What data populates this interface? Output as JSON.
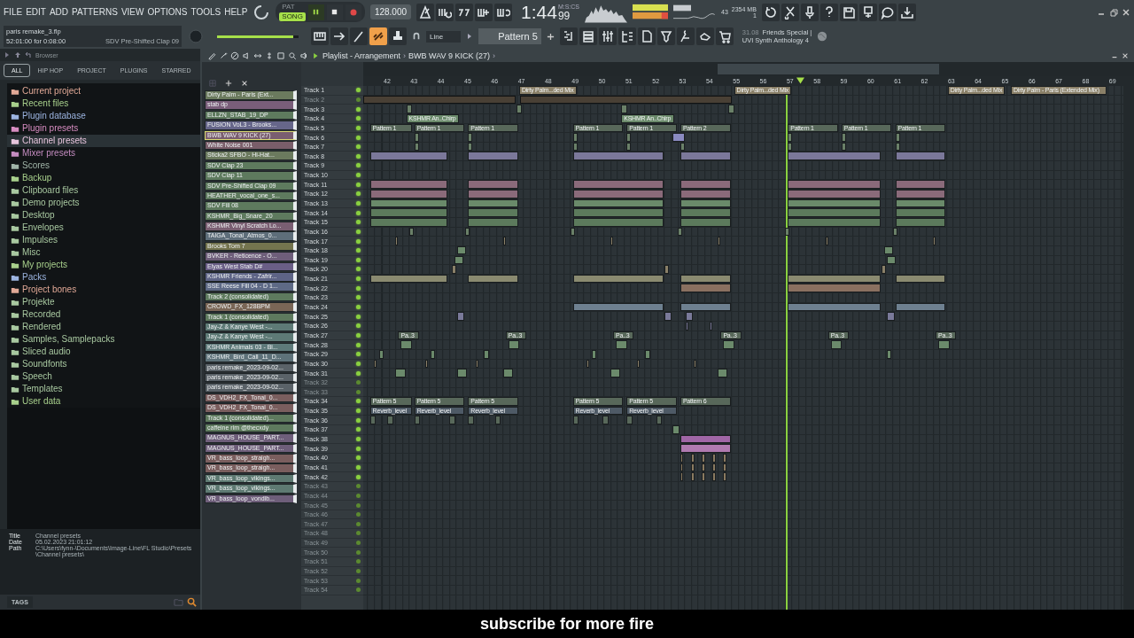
{
  "menu": [
    "FILE",
    "EDIT",
    "ADD",
    "PATTERNS",
    "VIEW",
    "OPTIONS",
    "TOOLS",
    "HELP"
  ],
  "transport": {
    "modes": [
      {
        "label": "PAT",
        "selected": false
      },
      {
        "label": "SONG",
        "selected": true
      }
    ],
    "tempo": "128.000",
    "time_main": "1:44",
    "time_cs": "99",
    "time_units": "M:S:CS"
  },
  "resources": {
    "polyphony": "43",
    "memory": "2354 MB",
    "cpu": "1"
  },
  "project": {
    "file": "paris remake_3.flp",
    "span": "52:01:00 for 0:08:00",
    "hint": "SDV Pre-Shifted Clap 09"
  },
  "master_volume": {
    "level": 0.93
  },
  "link_tool": {
    "on": true
  },
  "snap": {
    "value": "Line"
  },
  "pattern_selector": {
    "value": "Pattern 5"
  },
  "news": {
    "date": "31.08",
    "line1": "Friends Special |",
    "line2": "UVI Synth Anthology 4"
  },
  "browser": {
    "title": "Browser",
    "tabs": [
      {
        "label": "ALL",
        "selected": true
      },
      {
        "label": "HIP HOP",
        "selected": false
      },
      {
        "label": "PROJECT",
        "selected": false
      },
      {
        "label": "PLUGINS",
        "selected": false
      },
      {
        "label": "STARRED",
        "selected": false
      }
    ],
    "items": [
      {
        "label": "Current project",
        "color": "#e0a896",
        "selected": false
      },
      {
        "label": "Recent files",
        "color": "#a8d08c",
        "selected": false
      },
      {
        "label": "Plugin database",
        "color": "#9cb4e0",
        "selected": false
      },
      {
        "label": "Plugin presets",
        "color": "#d68cc0",
        "selected": false
      },
      {
        "label": "Channel presets",
        "color": "#e6c4dc",
        "selected": true
      },
      {
        "label": "Mixer presets",
        "color": "#c48cc0",
        "selected": false
      },
      {
        "label": "Scores",
        "color": "#a0b4a8",
        "selected": false
      },
      {
        "label": "Backup",
        "color": "#a8d08c",
        "selected": false
      },
      {
        "label": "Clipboard files",
        "color": "#a8c8a0",
        "selected": false
      },
      {
        "label": "Demo projects",
        "color": "#a8c8a0",
        "selected": false
      },
      {
        "label": "Desktop",
        "color": "#a8c8a0",
        "selected": false
      },
      {
        "label": "Envelopes",
        "color": "#a8c8a0",
        "selected": false
      },
      {
        "label": "Impulses",
        "color": "#a8c8a0",
        "selected": false
      },
      {
        "label": "Misc",
        "color": "#a8c8a0",
        "selected": false
      },
      {
        "label": "My projects",
        "color": "#a8d08c",
        "selected": false
      },
      {
        "label": "Packs",
        "color": "#9cb4e0",
        "selected": false
      },
      {
        "label": "Project bones",
        "color": "#e0a896",
        "selected": false
      },
      {
        "label": "Projekte",
        "color": "#a8c8a0",
        "selected": false
      },
      {
        "label": "Recorded",
        "color": "#a8c8a0",
        "selected": false
      },
      {
        "label": "Rendered",
        "color": "#a8c8a0",
        "selected": false
      },
      {
        "label": "Samples, Samplepacks",
        "color": "#a8c8a0",
        "selected": false
      },
      {
        "label": "Sliced audio",
        "color": "#a8c8a0",
        "selected": false
      },
      {
        "label": "Soundfonts",
        "color": "#a8c8a0",
        "selected": false
      },
      {
        "label": "Speech",
        "color": "#a8c8a0",
        "selected": false
      },
      {
        "label": "Templates",
        "color": "#a8c8a0",
        "selected": false
      },
      {
        "label": "User data",
        "color": "#a8d08c",
        "selected": false
      }
    ],
    "info": [
      {
        "key": "Title",
        "value": "Channel presets"
      },
      {
        "key": "Date",
        "value": "05.02.2023 21:01:12"
      },
      {
        "key": "Path",
        "value": "C:\\Users\\fynn-\\Documents\\Image-Line\\FL Studio\\Presets\\Channel presets\\"
      }
    ],
    "tags_label": "TAGS"
  },
  "playlist": {
    "title": "Playlist - Arrangement",
    "separator": "›",
    "current": "BWB WAV 9 KICK (27)",
    "end_separator": "›",
    "bars": [
      "42",
      "43",
      "44",
      "45",
      "46",
      "47",
      "48",
      "49",
      "50",
      "51",
      "52",
      "53",
      "54",
      "55",
      "56",
      "57",
      "58",
      "59",
      "60",
      "61",
      "62",
      "63",
      "64",
      "65",
      "66",
      "67",
      "68",
      "69"
    ],
    "channels": [
      {
        "name": "Dirty Palm - Paris (Ext...",
        "color": "#6b7a5e",
        "selected": false
      },
      {
        "name": "stab dp",
        "color": "#7a5e7a",
        "selected": false
      },
      {
        "name": "ELLZN_STAB_19_DP",
        "color": "#5e7a5e",
        "selected": false
      },
      {
        "name": "FUSION VoL3 - Brooks...",
        "color": "#66668a",
        "selected": false
      },
      {
        "name": "BWB WAV 9 KICK (27)",
        "color": "#7a5e70",
        "selected": true
      },
      {
        "name": "White Noise 001",
        "color": "#7a5e6a",
        "selected": false
      },
      {
        "name": "Sticka2 SFBO - Hi-Hat...",
        "color": "#6b7a5e",
        "selected": false
      },
      {
        "name": "SDV Clap 23",
        "color": "#5e7a5e",
        "selected": false
      },
      {
        "name": "SDV Clap 11",
        "color": "#5e7a5e",
        "selected": false
      },
      {
        "name": "SDV Pre-Shifted Clap 09",
        "color": "#5e7a5e",
        "selected": false
      },
      {
        "name": "HEATHER_vocal_one_s...",
        "color": "#5e7a5e",
        "selected": false
      },
      {
        "name": "SDV Fill 08",
        "color": "#5e7a5e",
        "selected": false
      },
      {
        "name": "KSHMR_Big_Snare_20",
        "color": "#5e7a5e",
        "selected": false
      },
      {
        "name": "KSHMR Vinyl Scratch Lo...",
        "color": "#7a5e72",
        "selected": false
      },
      {
        "name": "TAIGA_Tonal_Atmos_0...",
        "color": "#5e6e7a",
        "selected": false
      },
      {
        "name": "Brooks Tom 7",
        "color": "#74744e",
        "selected": false
      },
      {
        "name": "BVKER - Reticence - O...",
        "color": "#6e5e7a",
        "selected": false
      },
      {
        "name": "Elyas West Stab D#",
        "color": "#6a5e86",
        "selected": false
      },
      {
        "name": "KSHMR Friends - Zafrir...",
        "color": "#5e6486",
        "selected": false
      },
      {
        "name": "SSE Reese Fill 04 - D 1...",
        "color": "#5e6a86",
        "selected": false
      },
      {
        "name": "Track 2 (consolidated)",
        "color": "#5e7a5e",
        "selected": false
      },
      {
        "name": "CROWD_FX_128BPM",
        "color": "#7a6656",
        "selected": false
      },
      {
        "name": "Track 1 (consolidated)",
        "color": "#5e7a5e",
        "selected": false
      },
      {
        "name": "Jay-Z & Kanye West -...",
        "color": "#5e7a76",
        "selected": false
      },
      {
        "name": "Jay-Z & Kanye West -...",
        "color": "#5e7a76",
        "selected": false
      },
      {
        "name": "KSHMR Animals 03 - Bi...",
        "color": "#5e7a7a",
        "selected": false
      },
      {
        "name": "KSHMR_Bird_Call_11_D...",
        "color": "#5e727a",
        "selected": false
      },
      {
        "name": "paris remake_2023-09-02...",
        "color": "#5a6268",
        "selected": false
      },
      {
        "name": "paris remake_2023-09-02...",
        "color": "#5a6268",
        "selected": false
      },
      {
        "name": "paris remake_2023-09-02...",
        "color": "#5a6268",
        "selected": false
      },
      {
        "name": "DS_VDH2_FX_Tonal_0...",
        "color": "#7a5e5e",
        "selected": false
      },
      {
        "name": "DS_VDH2_FX_Tonal_0...",
        "color": "#7a5e5e",
        "selected": false
      },
      {
        "name": "Track 1 (consolidated)...",
        "color": "#5e7a5e",
        "selected": false
      },
      {
        "name": "caffeine rim @thecxdy",
        "color": "#5e7a5e",
        "selected": false
      },
      {
        "name": "MAGNUS_HOUSE_PART...",
        "color": "#6e5e7a",
        "selected": false
      },
      {
        "name": "MAGNUS_HOUSE_PART...",
        "color": "#6e5e7a",
        "selected": false
      },
      {
        "name": "VR_bass_loop_straigh...",
        "color": "#7a5e5e",
        "selected": false
      },
      {
        "name": "VR_bass_loop_straigh...",
        "color": "#7a5e5e",
        "selected": false
      },
      {
        "name": "VR_bass_loop_vikings...",
        "color": "#5e7a72",
        "selected": false
      },
      {
        "name": "VR_bass_loop_vikings...",
        "color": "#5e7a72",
        "selected": false
      },
      {
        "name": "VR_bass_loop_vondib...",
        "color": "#6e5e7a",
        "selected": false
      }
    ],
    "tracks": [
      {
        "name": "Track 1",
        "muted": false,
        "clips": [
          {
            "label": "Dirty Palm...ded Mix",
            "color": "#8a8068"
          },
          {
            "label": "Dirty Palm...ded Mix",
            "color": "#8a8068"
          },
          {
            "label": "Dirty Palm...ded Mix",
            "color": "#8a8068"
          },
          {
            "label": "Dirty Palm - Paris (Extended Mix)",
            "color": "#8a8068"
          }
        ]
      },
      {
        "name": "Track 2",
        "muted": true
      },
      {
        "name": "Track 3",
        "muted": false
      },
      {
        "name": "Track 4",
        "muted": false,
        "clips": [
          {
            "label": "KSHMR An..Chirp",
            "color": "#6b8a6b"
          },
          {
            "label": "KSHMR An..Chirp",
            "color": "#6b8a6b"
          }
        ]
      },
      {
        "name": "Track 5",
        "muted": false,
        "clips": [
          {
            "label": "Pattern 1",
            "color": "#58685a"
          },
          {
            "label": "Pattern 1",
            "color": "#58685a"
          },
          {
            "label": "Pattern 1",
            "color": "#58685a"
          },
          {
            "label": "Pattern 1",
            "color": "#58685a"
          },
          {
            "label": "Pattern 1",
            "color": "#58685a"
          },
          {
            "label": "Pattern 2",
            "color": "#58685a"
          },
          {
            "label": "Pattern 1",
            "color": "#58685a"
          },
          {
            "label": "Pattern 1",
            "color": "#58685a"
          },
          {
            "label": "Pattern 1",
            "color": "#58685a"
          }
        ]
      },
      {
        "name": "Track 6",
        "muted": false
      },
      {
        "name": "Track 7",
        "muted": false
      },
      {
        "name": "Track 8",
        "muted": false
      },
      {
        "name": "Track 9",
        "muted": false
      },
      {
        "name": "Track 10",
        "muted": false
      },
      {
        "name": "Track 11",
        "muted": false
      },
      {
        "name": "Track 12",
        "muted": false
      },
      {
        "name": "Track 13",
        "muted": false
      },
      {
        "name": "Track 14",
        "muted": false
      },
      {
        "name": "Track 15",
        "muted": false
      },
      {
        "name": "Track 16",
        "muted": false
      },
      {
        "name": "Track 17",
        "muted": false
      },
      {
        "name": "Track 18",
        "muted": false
      },
      {
        "name": "Track 19",
        "muted": false
      },
      {
        "name": "Track 20",
        "muted": false
      },
      {
        "name": "Track 21",
        "muted": false
      },
      {
        "name": "Track 22",
        "muted": false
      },
      {
        "name": "Track 23",
        "muted": false
      },
      {
        "name": "Track 24",
        "muted": false
      },
      {
        "name": "Track 25",
        "muted": false
      },
      {
        "name": "Track 26",
        "muted": false
      },
      {
        "name": "Track 27",
        "muted": false,
        "clips": [
          {
            "label": "Pa..3",
            "color": "#58685a"
          },
          {
            "label": "Pa..3",
            "color": "#58685a"
          },
          {
            "label": "Pa..3",
            "color": "#58685a"
          },
          {
            "label": "Pa..3",
            "color": "#58685a"
          },
          {
            "label": "Pa..3",
            "color": "#58685a"
          },
          {
            "label": "Pa..3",
            "color": "#58685a"
          }
        ]
      },
      {
        "name": "Track 28",
        "muted": false
      },
      {
        "name": "Track 29",
        "muted": false
      },
      {
        "name": "Track 30",
        "muted": false
      },
      {
        "name": "Track 31",
        "muted": false
      },
      {
        "name": "Track 32",
        "muted": true
      },
      {
        "name": "Track 33",
        "muted": true
      },
      {
        "name": "Track 34",
        "muted": false,
        "clips": [
          {
            "label": "Pattern 5",
            "color": "#58685a"
          },
          {
            "label": "Pattern 5",
            "color": "#58685a"
          },
          {
            "label": "Pattern 5",
            "color": "#58685a"
          },
          {
            "label": "Pattern 5",
            "color": "#58685a"
          },
          {
            "label": "Pattern 5",
            "color": "#58685a"
          },
          {
            "label": "Pattern 6",
            "color": "#58685a"
          }
        ]
      },
      {
        "name": "Track 35",
        "muted": false,
        "clips": [
          {
            "label": "Reverb_level",
            "color": "#4e5a66"
          },
          {
            "label": "Reverb_level",
            "color": "#4e5a66"
          },
          {
            "label": "Reverb_level",
            "color": "#4e5a66"
          },
          {
            "label": "Reverb_level",
            "color": "#4e5a66"
          },
          {
            "label": "Reverb_level",
            "color": "#4e5a66"
          }
        ]
      },
      {
        "name": "Track 36",
        "muted": false
      },
      {
        "name": "Track 37",
        "muted": false
      },
      {
        "name": "Track 38",
        "muted": false
      },
      {
        "name": "Track 39",
        "muted": false
      },
      {
        "name": "Track 40",
        "muted": false
      },
      {
        "name": "Track 41",
        "muted": false
      },
      {
        "name": "Track 42",
        "muted": false
      },
      {
        "name": "Track 43",
        "muted": true
      },
      {
        "name": "Track 44",
        "muted": true
      },
      {
        "name": "Track 45",
        "muted": true
      },
      {
        "name": "Track 46",
        "muted": true
      },
      {
        "name": "Track 47",
        "muted": true
      },
      {
        "name": "Track 48",
        "muted": true
      },
      {
        "name": "Track 49",
        "muted": true
      },
      {
        "name": "Track 50",
        "muted": true
      },
      {
        "name": "Track 51",
        "muted": true
      },
      {
        "name": "Track 52",
        "muted": true
      },
      {
        "name": "Track 53",
        "muted": true
      },
      {
        "name": "Track 54",
        "muted": true
      }
    ]
  },
  "caption": "subscribe for more fire"
}
